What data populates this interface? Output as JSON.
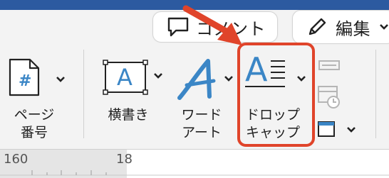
{
  "header": {
    "comment_button": "コメント",
    "edit_button": "編集"
  },
  "ribbon": {
    "page_number": {
      "line1": "ページ",
      "line2": "番号",
      "icon_glyph": "#"
    },
    "horizontal_text": {
      "label": "横書き",
      "icon_glyph": "A"
    },
    "wordart": {
      "line1": "ワード",
      "line2": "アート"
    },
    "drop_cap": {
      "line1": "ドロップ",
      "line2": "キャップ",
      "icon_glyph": "A"
    }
  },
  "ruler": {
    "mark_160": "160",
    "mark_next": "18"
  },
  "colors": {
    "accent_blue": "#3b86c6",
    "highlight_red": "#e0442a",
    "top_bar": "#2c5aa0"
  }
}
